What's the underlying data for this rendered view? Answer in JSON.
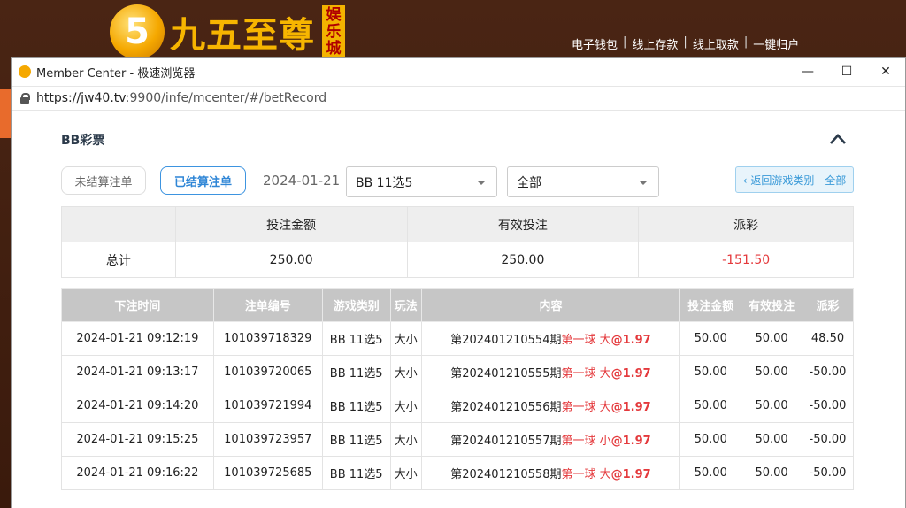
{
  "site": {
    "logo_digit": "5",
    "logo_text": "九五至尊",
    "logo_badge": [
      "娱",
      "乐",
      "城"
    ],
    "nav": [
      "电子钱包",
      "线上存款",
      "线上取款",
      "一键归户"
    ]
  },
  "window": {
    "title": "Member Center - 极速浏览器",
    "url_host": "https://jw40.tv",
    "url_rest": ":9900/infe/mcenter/#/betRecord",
    "controls": [
      "—",
      "☐",
      "✕"
    ]
  },
  "section": {
    "title": "BB彩票"
  },
  "filters": {
    "unsettled": "未结算注单",
    "settled": "已结算注单",
    "date": "2024-01-21",
    "game_select": "BB 11选5",
    "type_select": "全部",
    "back": "‹ 返回游戏类别 - 全部"
  },
  "summary": {
    "headers": [
      "",
      "投注金额",
      "有效投注",
      "派彩"
    ],
    "row": {
      "label": "总计",
      "bet": "250.00",
      "valid": "250.00",
      "payout": "-151.50"
    }
  },
  "records": {
    "headers": [
      "下注时间",
      "注单编号",
      "游戏类别",
      "玩法",
      "内容",
      "投注金额",
      "有效投注",
      "派彩"
    ],
    "rows": [
      {
        "time": "2024-01-21 09:12:19",
        "id": "101039718329",
        "game": "BB 11选5",
        "play": "大小",
        "period": "第202401210554期",
        "pick": "第一球 大",
        "odds": "1.97",
        "bet": "50.00",
        "valid": "50.00",
        "payout": "48.50"
      },
      {
        "time": "2024-01-21 09:13:17",
        "id": "101039720065",
        "game": "BB 11选5",
        "play": "大小",
        "period": "第202401210555期",
        "pick": "第一球 大",
        "odds": "1.97",
        "bet": "50.00",
        "valid": "50.00",
        "payout": "-50.00"
      },
      {
        "time": "2024-01-21 09:14:20",
        "id": "101039721994",
        "game": "BB 11选5",
        "play": "大小",
        "period": "第202401210556期",
        "pick": "第一球 大",
        "odds": "1.97",
        "bet": "50.00",
        "valid": "50.00",
        "payout": "-50.00"
      },
      {
        "time": "2024-01-21 09:15:25",
        "id": "101039723957",
        "game": "BB 11选5",
        "play": "大小",
        "period": "第202401210557期",
        "pick": "第一球 小",
        "odds": "1.97",
        "bet": "50.00",
        "valid": "50.00",
        "payout": "-50.00"
      },
      {
        "time": "2024-01-21 09:16:22",
        "id": "101039725685",
        "game": "BB 11选5",
        "play": "大小",
        "period": "第202401210558期",
        "pick": "第一球 大",
        "odds": "1.97",
        "bet": "50.00",
        "valid": "50.00",
        "payout": "-50.00"
      }
    ]
  },
  "colors": {
    "negative": "#e4393c",
    "accent": "#2f86d6",
    "logo_gold": "#f7b500"
  }
}
